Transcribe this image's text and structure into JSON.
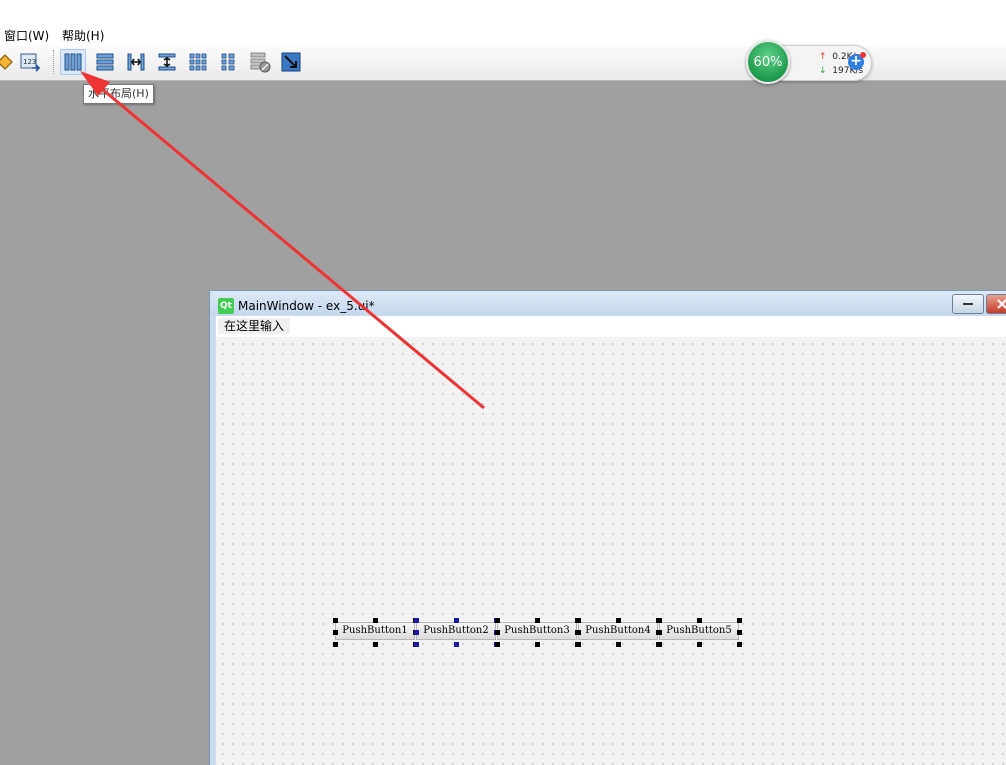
{
  "menu": {
    "window_label": "窗口(W)",
    "help_label": "帮助(H)"
  },
  "toolbar": {
    "icons": [
      "edit-buddies-icon",
      "tab-order-icon",
      "layout-horizontal-icon",
      "layout-vertical-icon",
      "layout-horizontal-splitter-icon",
      "layout-vertical-splitter-icon",
      "layout-grid-icon",
      "layout-form-icon",
      "break-layout-icon",
      "adjust-size-icon"
    ],
    "tooltip": "水平布局(H)"
  },
  "net_monitor": {
    "percent": "60%",
    "upload": "0.2K/s",
    "download": "197K/s"
  },
  "form_window": {
    "title": "MainWindow - ex_5.ui*",
    "qt_logo": "Qt",
    "menu_placeholder": "在这里输入",
    "buttons": [
      "PushButton1",
      "PushButton2",
      "PushButton3",
      "PushButton4",
      "PushButton5"
    ]
  },
  "colors": {
    "arrow": "#ee3333",
    "accent": "#2f7fe0",
    "desktop": "#a0a0a0"
  }
}
